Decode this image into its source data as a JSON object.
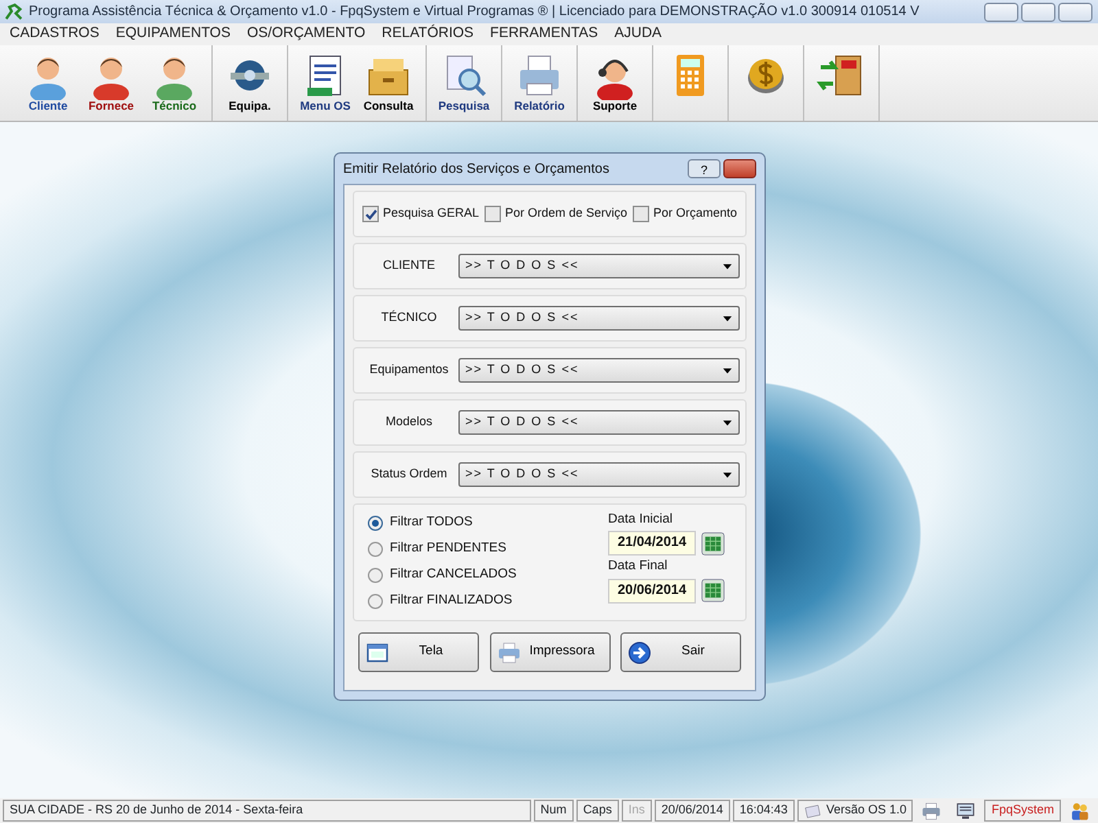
{
  "window": {
    "title": "Programa Assistência Técnica & Orçamento v1.0 - FpqSystem e Virtual Programas ® | Licenciado para  DEMONSTRAÇÃO v1.0 300914 010514 V"
  },
  "menu": [
    "CADASTROS",
    "EQUIPAMENTOS",
    "OS/ORÇAMENTO",
    "RELATÓRIOS",
    "FERRAMENTAS",
    "AJUDA"
  ],
  "toolbar": [
    [
      {
        "kind": "client",
        "label": "Cliente"
      },
      {
        "kind": "supplier",
        "label": "Fornece"
      },
      {
        "kind": "technician",
        "label": "Técnico"
      }
    ],
    [
      {
        "kind": "equipment",
        "label": "Equipa."
      }
    ],
    [
      {
        "kind": "orders",
        "label": "Menu OS"
      },
      {
        "kind": "archive",
        "label": "Consulta"
      }
    ],
    [
      {
        "kind": "search",
        "label": "Pesquisa"
      }
    ],
    [
      {
        "kind": "report",
        "label": "Relatório"
      }
    ],
    [
      {
        "kind": "support",
        "label": "Suporte"
      }
    ],
    [
      {
        "kind": "calculator"
      }
    ],
    [
      {
        "kind": "coin"
      }
    ],
    [
      {
        "kind": "exit"
      }
    ]
  ],
  "dialog": {
    "title": "Emitir Relatório dos Serviços e Orçamentos",
    "help_button": "?",
    "checkboxes": [
      {
        "label": "Pesquisa GERAL",
        "checked": true
      },
      {
        "label": "Por Ordem de Serviço",
        "checked": false
      },
      {
        "label": "Por Orçamento",
        "checked": false
      }
    ],
    "filters": [
      {
        "label": "CLIENTE",
        "value": ">> T O D O S <<"
      },
      {
        "label": "TÉCNICO",
        "value": ">> T O D O S <<"
      },
      {
        "label": "Equipamentos",
        "value": ">> T O D O S <<"
      },
      {
        "label": "Modelos",
        "value": ">> T O D O S <<"
      },
      {
        "label": "Status Ordem",
        "value": ">> T O D O S <<"
      }
    ],
    "radios": [
      {
        "label": "Filtrar TODOS",
        "selected": true
      },
      {
        "label": "Filtrar PENDENTES",
        "selected": false
      },
      {
        "label": "Filtrar CANCELADOS",
        "selected": false
      },
      {
        "label": "Filtrar FINALIZADOS",
        "selected": false
      }
    ],
    "dates": [
      {
        "label": "Data Inicial",
        "value": "21/04/2014"
      },
      {
        "label": "Data Final",
        "value": "20/06/2014"
      }
    ],
    "buttons": [
      {
        "kind": "screen",
        "label": "Tela"
      },
      {
        "kind": "printer",
        "label": "Impressora"
      },
      {
        "kind": "exit",
        "label": "Sair"
      }
    ]
  },
  "status_bar": [
    {
      "kind": "text",
      "text": "SUA CIDADE - RS 20 de Junho de 2014 - Sexta-feira",
      "disabled": false
    },
    {
      "kind": "text",
      "text": "Num",
      "disabled": false
    },
    {
      "kind": "text",
      "text": "Caps",
      "disabled": false
    },
    {
      "kind": "text",
      "text": "Ins",
      "disabled": true
    },
    {
      "kind": "text",
      "text": "20/06/2014",
      "disabled": false
    },
    {
      "kind": "text",
      "text": "16:04:43",
      "disabled": false
    },
    {
      "kind": "version",
      "text": "Versão OS 1.0",
      "disabled": false
    },
    {
      "kind": "printer"
    },
    {
      "kind": "monitor"
    },
    {
      "kind": "brand",
      "text": "FpqSystem",
      "disabled": false
    },
    {
      "kind": "users"
    }
  ]
}
